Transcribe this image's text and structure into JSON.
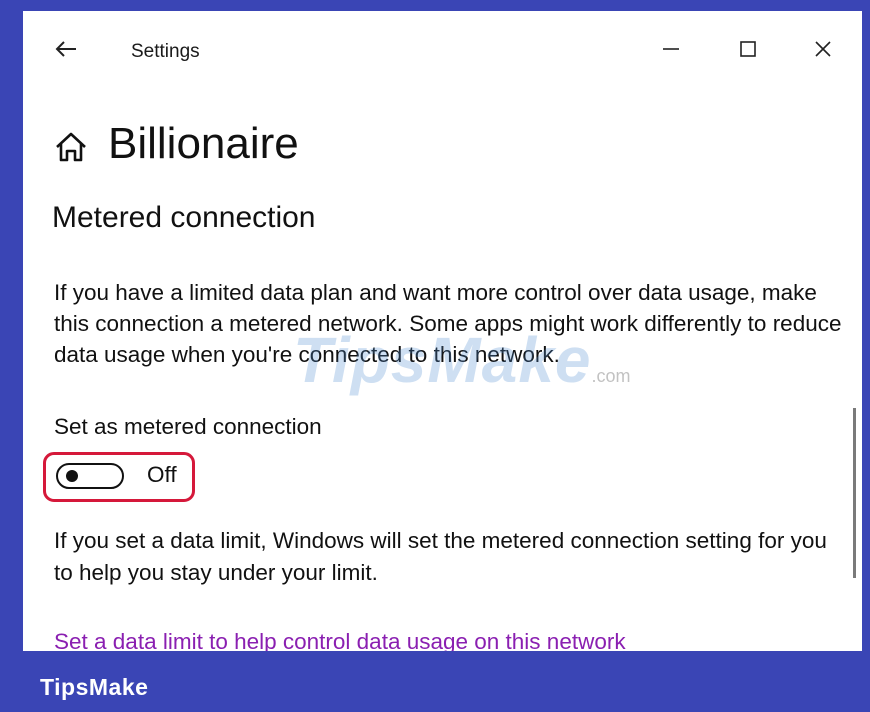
{
  "window": {
    "app_title": "Settings",
    "controls": {
      "back_icon": "arrow-left-icon",
      "minimize_icon": "minimize-icon",
      "maximize_icon": "maximize-icon",
      "close_icon": "close-icon"
    }
  },
  "page": {
    "home_icon": "home-icon",
    "title": "Billionaire",
    "section_title": "Metered connection",
    "description": "If you have a limited data plan and want more control over data usage, make this connection a metered network. Some apps might work differently to reduce data usage when you're connected to this network.",
    "toggle": {
      "label": "Set as metered connection",
      "state_text": "Off",
      "is_on": false
    },
    "limit_description": "If you set a data limit, Windows will set the metered connection setting for you to help you stay under your limit.",
    "link_text": "Set a data limit to help control data usage on this network"
  },
  "watermark": {
    "text": "TipsMake",
    "suffix": ".com"
  },
  "footer": {
    "brand": "TipsMake"
  },
  "colors": {
    "frame": "#3a45b5",
    "highlight": "#d5183a",
    "link": "#8a1fb1"
  }
}
